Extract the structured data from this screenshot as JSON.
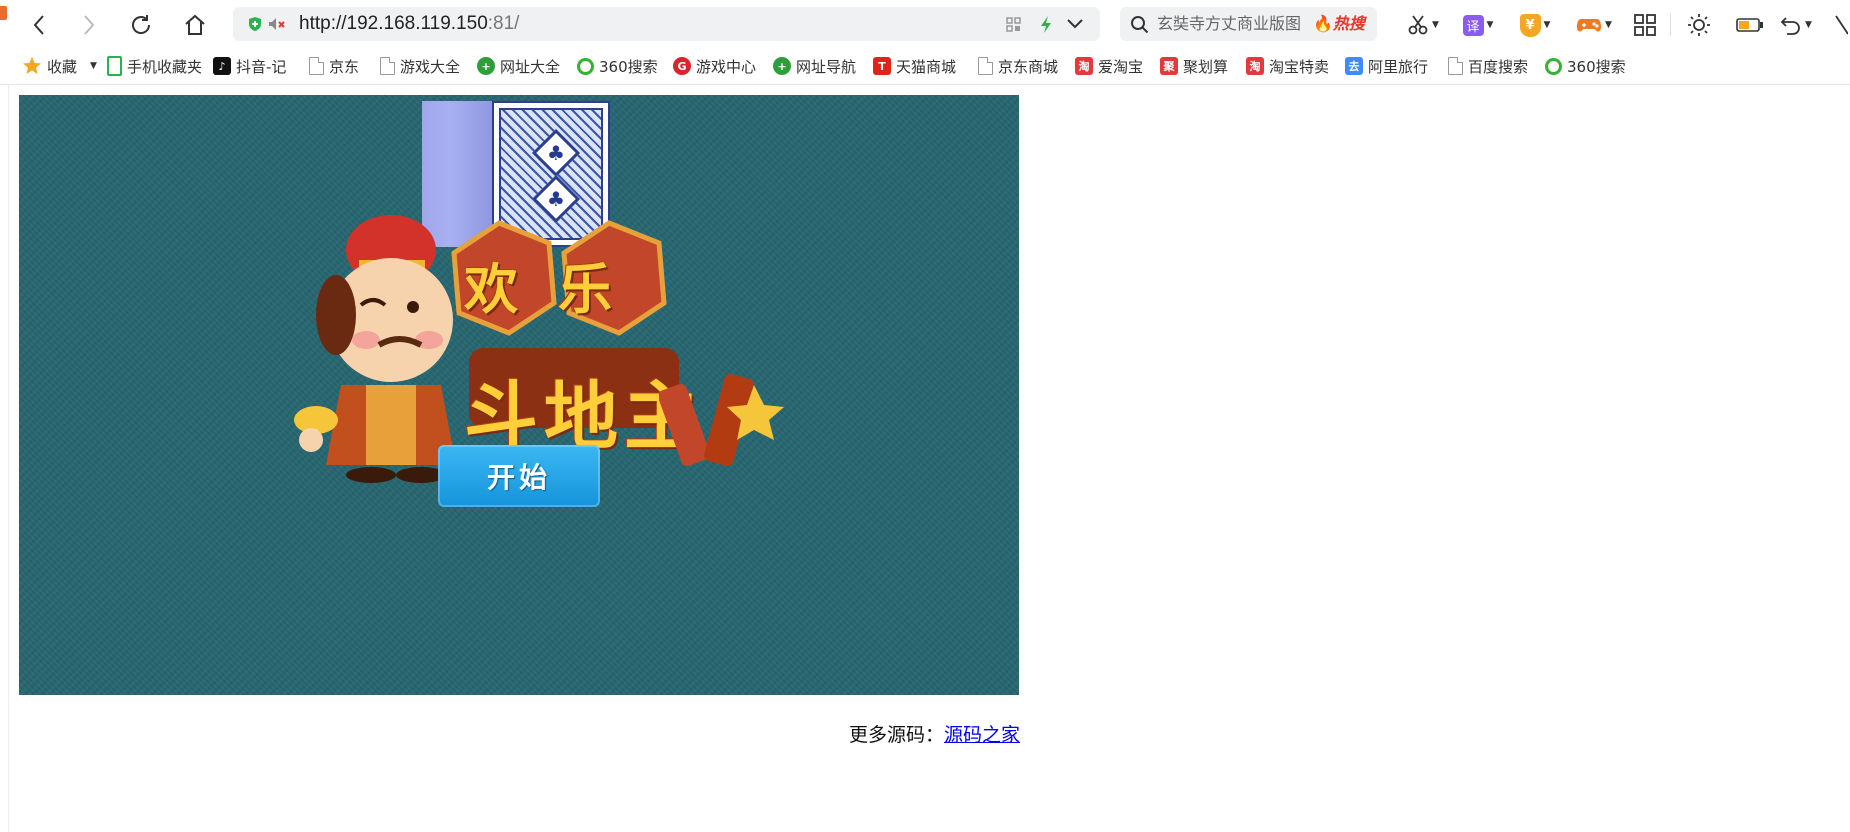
{
  "toolbar": {
    "url_host": "http://192.168.119.150",
    "url_port_path": ":81/",
    "search_placeholder": "玄奘寺方丈商业版图",
    "search_hot_label": "热搜",
    "translate_label": "译",
    "coupon_label": "¥"
  },
  "bookmarks": [
    {
      "label": "收藏",
      "icon": "star-icon",
      "color": "#f5a623"
    },
    {
      "label": "手机收藏夹",
      "icon": "phone-icon",
      "color": "#2bb24c"
    },
    {
      "label": "抖音-记",
      "icon": "tiktok-icon",
      "color": "#111111"
    },
    {
      "label": "京东",
      "icon": "page-icon",
      "color": "#999999"
    },
    {
      "label": "游戏大全",
      "icon": "page-icon",
      "color": "#999999"
    },
    {
      "label": "网址大全",
      "icon": "nav-plus-icon",
      "color": "#2e9e3a"
    },
    {
      "label": "360搜索",
      "icon": "360-search-icon",
      "color": "#34b233"
    },
    {
      "label": "游戏中心",
      "icon": "game-center-icon",
      "color": "#d9232d"
    },
    {
      "label": "网址导航",
      "icon": "nav-plus-icon",
      "color": "#2e9e3a"
    },
    {
      "label": "天猫商城",
      "icon": "tmall-icon",
      "color": "#e2231a"
    },
    {
      "label": "京东商城",
      "icon": "page-icon",
      "color": "#999999"
    },
    {
      "label": "爱淘宝",
      "icon": "taobao-icon",
      "color": "#e4393c"
    },
    {
      "label": "聚划算",
      "icon": "juhuasuan-icon",
      "color": "#e4393c"
    },
    {
      "label": "淘宝特卖",
      "icon": "taobao-icon",
      "color": "#e4393c"
    },
    {
      "label": "阿里旅行",
      "icon": "travel-icon",
      "color": "#3d8bfd"
    },
    {
      "label": "百度搜索",
      "icon": "page-icon",
      "color": "#999999"
    },
    {
      "label": "360搜索",
      "icon": "360-search-icon",
      "color": "#34b233"
    }
  ],
  "game": {
    "title_line1": "欢乐",
    "title_line2": "斗地主",
    "start_label": "开始",
    "background_color": "#266670",
    "button_color": "#1fa3e6"
  },
  "footer": {
    "prefix": "更多源码：",
    "link_text": "源码之家"
  }
}
